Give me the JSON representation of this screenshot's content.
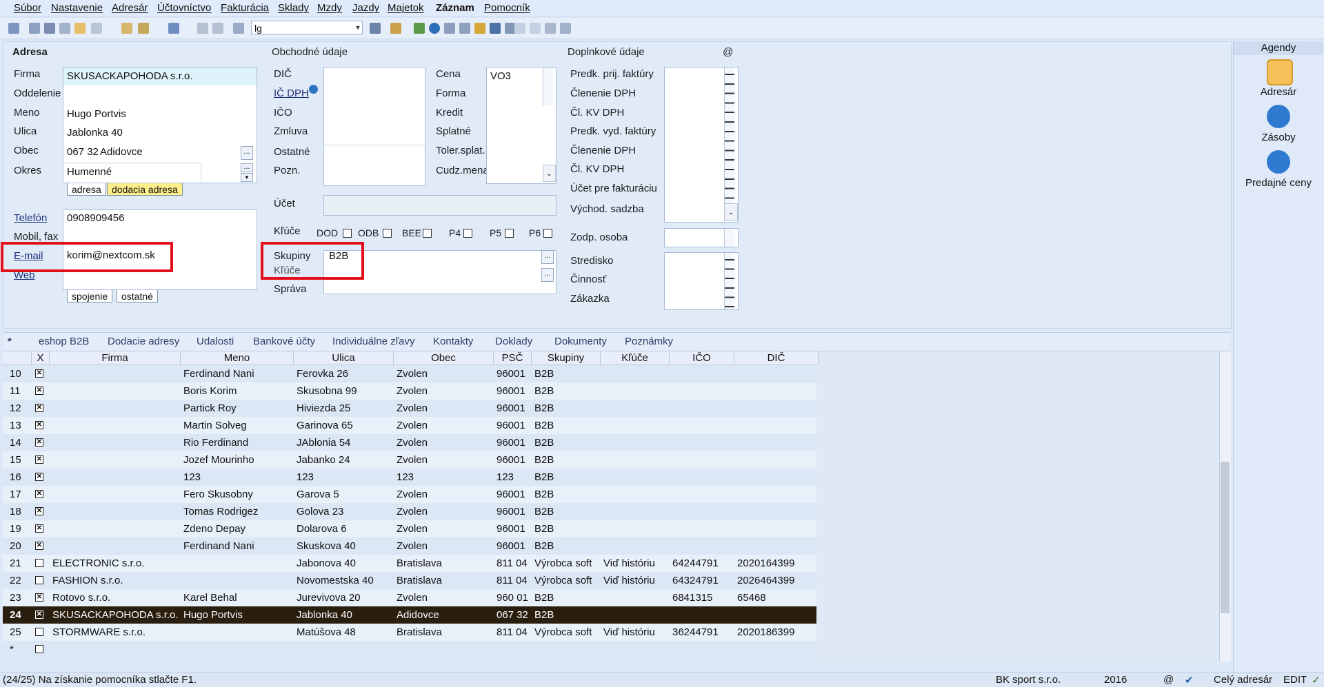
{
  "menu": [
    "Súbor",
    "Nastavenie",
    "Adresár",
    "Účtovníctvo",
    "Fakturácia",
    "Sklady",
    "Mzdy",
    "Jazdy",
    "Majetok",
    "Záznam",
    "Pomocník"
  ],
  "toolbar": {
    "combo_value": "lg"
  },
  "adresa": {
    "header": "Adresa",
    "labels": {
      "firma": "Firma",
      "oddelenie": "Oddelenie",
      "meno": "Meno",
      "ulica": "Ulica",
      "obec": "Obec",
      "okres": "Okres",
      "telefon": "Telefón",
      "mobil": "Mobil, fax",
      "email": "E-mail",
      "web": "Web"
    },
    "firma": "SKUSACKAPOHODA s.r.o.",
    "meno": "Hugo Portvis",
    "ulica": "Jablonka 40",
    "psc": "067 32",
    "obec": "Adidovce",
    "okres": "Humenné",
    "telefon": "0908909456",
    "email": "korim@nextcom.sk",
    "tab_adresa": "adresa",
    "tab_dodacia": "dodacia adresa",
    "tab_spojenie": "spojenie",
    "tab_ostatne": "ostatné"
  },
  "obchodne": {
    "header": "Obchodné údaje",
    "labels": {
      "dic": "DIČ",
      "icdph": "IČ DPH",
      "ico": "IČO",
      "zmluva": "Zmluva",
      "ostatne": "Ostatné",
      "pozn": "Pozn.",
      "ucet": "Účet",
      "kluce": "Kľúče",
      "skupiny": "Skupiny",
      "kruce": "Kľúče",
      "sprava": "Správa",
      "cena": "Cena",
      "forma": "Forma",
      "kredit": "Kredit",
      "splatne": "Splatné",
      "toler": "Toler.splat.",
      "cudz": "Cudz.mena"
    },
    "cena": "VO3",
    "skupiny": "B2B",
    "keys": [
      "DOD",
      "ODB",
      "BEE",
      "P4",
      "P5",
      "P6"
    ]
  },
  "doplnkove": {
    "header": "Doplnkové údaje",
    "at": "@",
    "labels": [
      "Predk. prij. faktúry",
      "Členenie DPH",
      "Čl. KV DPH",
      "Predk. vyd. faktúry",
      "Členenie DPH",
      "Čl. KV DPH",
      "Účet pre fakturáciu",
      "Východ. sadzba"
    ],
    "zodp": "Zodp. osoba",
    "labels2": [
      "Stredisko",
      "Činnosť",
      "Zákazka"
    ]
  },
  "agendy": {
    "title": "Agendy",
    "items": [
      "Adresár",
      "Zásoby",
      "Predajné ceny"
    ]
  },
  "tabs": [
    "*",
    "eshop B2B",
    "Dodacie adresy",
    "Udalosti",
    "Bankové účty",
    "Individuálne zľavy",
    "Kontakty",
    "Doklady",
    "Dokumenty",
    "Poznámky"
  ],
  "grid": {
    "columns": [
      "X",
      "Firma",
      "Meno",
      "Ulica",
      "Obec",
      "PSČ",
      "Skupiny",
      "Kľúče",
      "IČO",
      "DIČ"
    ],
    "rows": [
      {
        "n": "10",
        "x": true,
        "firma": "",
        "meno": "Ferdinand Nani",
        "ulica": "Ferovka 26",
        "obec": "Zvolen",
        "psc": "96001",
        "skup": "B2B",
        "kluce": "",
        "ico": "",
        "dic": ""
      },
      {
        "n": "11",
        "x": true,
        "firma": "",
        "meno": "Boris Korim",
        "ulica": "Skusobna 99",
        "obec": "Zvolen",
        "psc": "96001",
        "skup": "B2B",
        "kluce": "",
        "ico": "",
        "dic": ""
      },
      {
        "n": "12",
        "x": true,
        "firma": "",
        "meno": "Partick Roy",
        "ulica": "Hiviezda 25",
        "obec": "Zvolen",
        "psc": "96001",
        "skup": "B2B",
        "kluce": "",
        "ico": "",
        "dic": ""
      },
      {
        "n": "13",
        "x": true,
        "firma": "",
        "meno": "Martin Solveg",
        "ulica": "Garinova 65",
        "obec": "Zvolen",
        "psc": "96001",
        "skup": "B2B",
        "kluce": "",
        "ico": "",
        "dic": ""
      },
      {
        "n": "14",
        "x": true,
        "firma": "",
        "meno": "Rio Ferdinand",
        "ulica": "JAblonia 54",
        "obec": "Zvolen",
        "psc": "96001",
        "skup": "B2B",
        "kluce": "",
        "ico": "",
        "dic": ""
      },
      {
        "n": "15",
        "x": true,
        "firma": "",
        "meno": "Jozef Mourinho",
        "ulica": "Jabanko 24",
        "obec": "Zvolen",
        "psc": "96001",
        "skup": "B2B",
        "kluce": "",
        "ico": "",
        "dic": ""
      },
      {
        "n": "16",
        "x": true,
        "firma": "",
        "meno": "123",
        "ulica": "123",
        "obec": "123",
        "psc": "123",
        "skup": "B2B",
        "kluce": "",
        "ico": "",
        "dic": ""
      },
      {
        "n": "17",
        "x": true,
        "firma": "",
        "meno": "Fero Skusobny",
        "ulica": "Garova 5",
        "obec": "Zvolen",
        "psc": "96001",
        "skup": "B2B",
        "kluce": "",
        "ico": "",
        "dic": ""
      },
      {
        "n": "18",
        "x": true,
        "firma": "",
        "meno": "Tomas Rodrigez",
        "ulica": "Golova 23",
        "obec": "Zvolen",
        "psc": "96001",
        "skup": "B2B",
        "kluce": "",
        "ico": "",
        "dic": ""
      },
      {
        "n": "19",
        "x": true,
        "firma": "",
        "meno": "Zdeno Depay",
        "ulica": "Dolarova 6",
        "obec": "Zvolen",
        "psc": "96001",
        "skup": "B2B",
        "kluce": "",
        "ico": "",
        "dic": ""
      },
      {
        "n": "20",
        "x": true,
        "firma": "",
        "meno": "Ferdinand Nani",
        "ulica": "Skuskova 40",
        "obec": "Zvolen",
        "psc": "96001",
        "skup": "B2B",
        "kluce": "",
        "ico": "",
        "dic": ""
      },
      {
        "n": "21",
        "x": false,
        "firma": "ELECTRONIC s.r.o.",
        "meno": "",
        "ulica": "Jabonova 40",
        "obec": "Bratislava",
        "psc": "811 04",
        "skup": "Výrobca soft",
        "kluce": "Viď históriu",
        "ico": "64244791",
        "dic": "2020164399"
      },
      {
        "n": "22",
        "x": false,
        "firma": "FASHION s.r.o.",
        "meno": "",
        "ulica": "Novomestska 40",
        "obec": "Bratislava",
        "psc": "811 04",
        "skup": "Výrobca soft",
        "kluce": "Viď históriu",
        "ico": "64324791",
        "dic": "2026464399"
      },
      {
        "n": "23",
        "x": true,
        "firma": "Rotovo s.r.o.",
        "meno": "Karel Behal",
        "ulica": "Jurevivova 20",
        "obec": "Zvolen",
        "psc": "960 01",
        "skup": "B2B",
        "kluce": "",
        "ico": "6841315",
        "dic": "65468"
      },
      {
        "n": "24",
        "x": true,
        "firma": "SKUSACKAPOHODA s.r.o.",
        "meno": "Hugo Portvis",
        "ulica": "Jablonka 40",
        "obec": "Adidovce",
        "psc": "067 32",
        "skup": "B2B",
        "kluce": "",
        "ico": "",
        "dic": "",
        "selected": true
      },
      {
        "n": "25",
        "x": false,
        "firma": "STORMWARE s.r.o.",
        "meno": "",
        "ulica": "Matúšova 48",
        "obec": "Bratislava",
        "psc": "811 04",
        "skup": "Výrobca soft",
        "kluce": "Viď históriu",
        "ico": "36244791",
        "dic": "2020186399"
      },
      {
        "n": "*",
        "x": false,
        "firma": "",
        "meno": "",
        "ulica": "",
        "obec": "",
        "psc": "",
        "skup": "",
        "kluce": "",
        "ico": "",
        "dic": ""
      }
    ]
  },
  "status": {
    "left": "(24/25) Na získanie pomocníka stlačte F1.",
    "company": "BK sport  s.r.o.",
    "year": "2016",
    "at": "@",
    "scope": "Celý adresár",
    "mode": "EDIT"
  },
  "colors": {
    "highlight_red": "#e3101b",
    "selected_row": "#2a1e0f",
    "firma_field": "#dff3fb",
    "tab_yellow": "#ffef8a"
  }
}
